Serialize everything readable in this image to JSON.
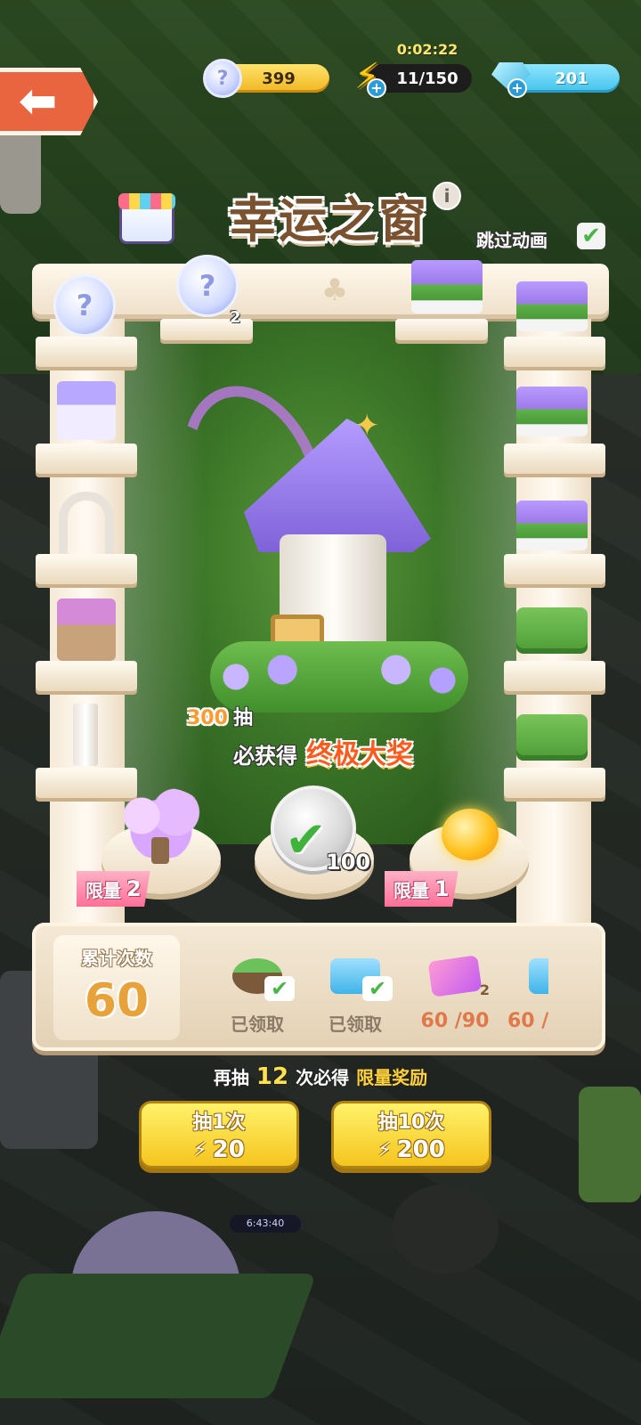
{
  "hud": {
    "timer": "0:02:22",
    "coins": "399",
    "energy": "11/150",
    "gems": "201",
    "coin_glyph": "?",
    "plus": "+"
  },
  "nav": {
    "back_arrow": "⬅"
  },
  "title": {
    "text": "幸运之窗",
    "info_glyph": "i",
    "skip_label": "跳过动画",
    "skip_checked": true,
    "check_glyph": "✔"
  },
  "shelves": {
    "top_token_qty": "2",
    "q_glyph": "?"
  },
  "grand_prize": {
    "draws": "300",
    "draws_unit": "抽",
    "guarantee_text": "必获得",
    "prize_name": "终极大奖"
  },
  "pedestals": {
    "left_limit_label": "限量",
    "left_limit_value": "2",
    "center_qty": "100",
    "right_limit_label": "限量",
    "right_limit_value": "1"
  },
  "counter": {
    "label": "累计次数",
    "value": "60"
  },
  "rewards": [
    {
      "status": "已领取",
      "color": "#6b4a2a"
    },
    {
      "status": "已领取",
      "color": "#3fb4e8"
    },
    {
      "qty": "2",
      "progress": "60 /90",
      "color": "#c35cf0"
    },
    {
      "progress": "60 /",
      "color": "#3fb4e8"
    }
  ],
  "footer": {
    "more_prefix": "再抽",
    "more_count": "12",
    "more_mid": "次必得",
    "more_reward": "限量奖励",
    "draw1_label": "抽1次",
    "draw1_cost": "20",
    "draw10_label": "抽10次",
    "draw10_cost": "200",
    "bolt_glyph": "⚡",
    "world_timer": "6:43:40"
  },
  "colors": {
    "accent_gold": "#f5c51f",
    "limit_pink": "#ff6f98",
    "back_orange": "#e8653f"
  }
}
